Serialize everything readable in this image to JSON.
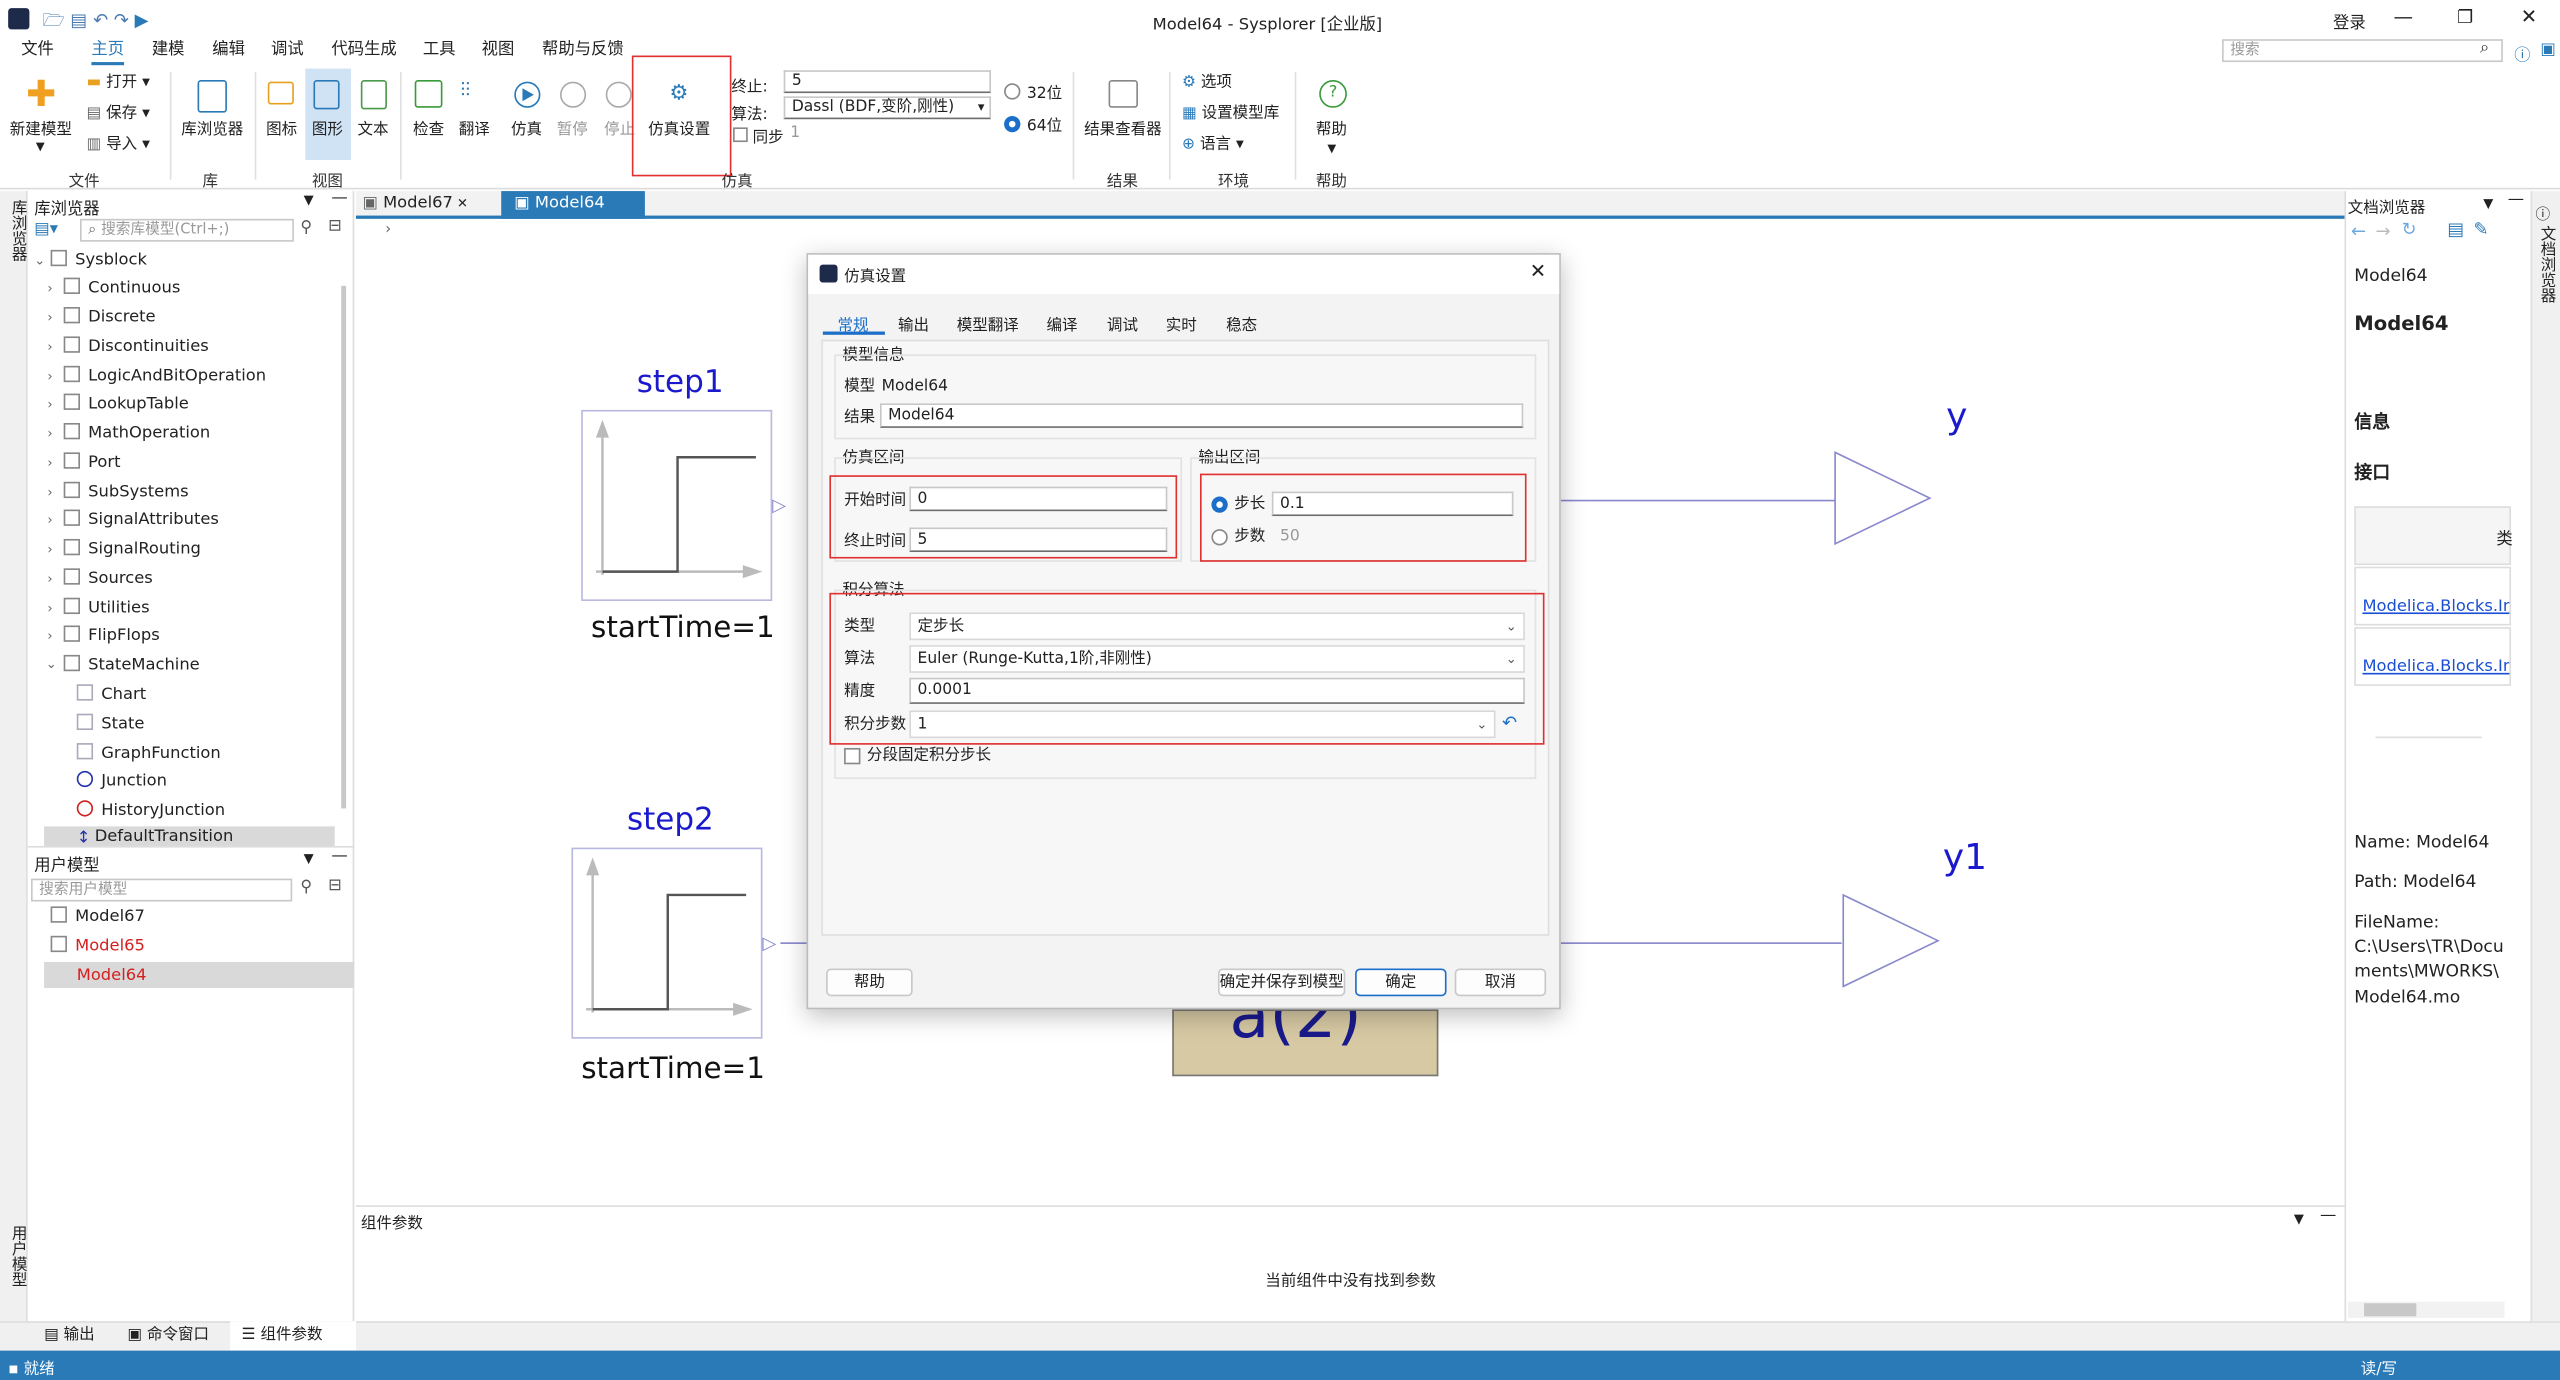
{
  "window": {
    "title": "Model64 - Sysplorer [企业版]",
    "login": "登录",
    "search_placeholder": "搜索"
  },
  "menu": [
    "文件",
    "主页",
    "建模",
    "编辑",
    "调试",
    "代码生成",
    "工具",
    "视图",
    "帮助与反馈"
  ],
  "ribbon": {
    "file": {
      "new_model": "新建模型",
      "open": "打开",
      "save": "保存",
      "import": "导入",
      "group": "文件"
    },
    "lib": {
      "browser": "库浏览器",
      "group": "库"
    },
    "view": {
      "icon": "图标",
      "diagram": "图形",
      "text": "文本",
      "group": "视图"
    },
    "sim": {
      "check": "检查",
      "translate": "翻译",
      "simulate": "仿真",
      "pause": "暂停",
      "stop": "停止",
      "settings": "仿真设置",
      "group": "仿真",
      "stop_label": "终止:",
      "stop_value": "5",
      "alg_label": "算法:",
      "alg_value": "Dassl (BDF,变阶,刚性)",
      "sync": "同步",
      "sync_value": "1",
      "bit32": "32位",
      "bit64": "64位"
    },
    "result": {
      "viewer": "结果查看器",
      "group": "结果"
    },
    "env": {
      "options": "选项",
      "set_lib": "设置模型库",
      "language": "语言",
      "group": "环境"
    },
    "help": {
      "help": "帮助",
      "group": "帮助"
    }
  },
  "left_panel": {
    "title": "库浏览器",
    "search_placeholder": "搜索库模型(Ctrl+;)",
    "root": "Sysblock",
    "items": [
      "Continuous",
      "Discrete",
      "Discontinuities",
      "LogicAndBitOperation",
      "LookupTable",
      "MathOperation",
      "Port",
      "SubSystems",
      "SignalAttributes",
      "SignalRouting",
      "Sources",
      "Utilities",
      "FlipFlops",
      "StateMachine"
    ],
    "sm_children": [
      "Chart",
      "State",
      "GraphFunction",
      "Junction",
      "HistoryJunction",
      "DefaultTransition"
    ],
    "user_title": "用户模型",
    "user_search": "搜索用户模型",
    "user_models": [
      "Model67",
      "Model65",
      "Model64"
    ],
    "side_tab_top": "库浏览器",
    "side_tab_bottom": "用户模型"
  },
  "tabs": [
    "Model67",
    "Model64"
  ],
  "canvas": {
    "step1": "step1",
    "step2": "step2",
    "start1": "startTime=1",
    "start2": "startTime=1",
    "y": "y",
    "y1": "y1",
    "behind": "a(2)"
  },
  "params_panel": {
    "title": "组件参数",
    "empty": "当前组件中没有找到参数"
  },
  "bottom_tabs": [
    "输出",
    "命令窗口",
    "组件参数"
  ],
  "status": {
    "left": "就绪",
    "right": "读/写"
  },
  "right_panel": {
    "title": "文档浏览器",
    "side_tab": "文档浏览器",
    "model": "Model64",
    "model_bold": "Model64",
    "info": "信息",
    "interface": "接口",
    "col": "类",
    "link1": "Modelica.Blocks.In",
    "link2": "Modelica.Blocks.In",
    "name": "Name: Model64",
    "path": "Path: Model64",
    "filename": [
      "FileName:",
      "C:\\Users\\TR\\Docu",
      "ments\\MWORKS\\",
      "Model64.mo"
    ]
  },
  "dialog": {
    "title": "仿真设置",
    "tabs": [
      "常规",
      "输出",
      "模型翻译",
      "编译",
      "调试",
      "实时",
      "稳态"
    ],
    "model_info": "模型信息",
    "model_label": "模型",
    "model_value": "Model64",
    "result_label": "结果",
    "result_value": "Model64",
    "sim_interval": "仿真区间",
    "start_label": "开始时间",
    "start_value": "0",
    "stop_label": "终止时间",
    "stop_value": "5",
    "out_interval": "输出区间",
    "step_label": "步长",
    "step_value": "0.1",
    "count_label": "步数",
    "count_value": "50",
    "integ": "积分算法",
    "type_label": "类型",
    "type_value": "定步长",
    "alg_label": "算法",
    "alg_value": "Euler (Runge-Kutta,1阶,非刚性)",
    "prec_label": "精度",
    "prec_value": "0.0001",
    "steps_label": "积分步数",
    "steps_value": "1",
    "piecewise": "分段固定积分步长",
    "help": "帮助",
    "save_ok": "确定并保存到模型",
    "ok": "确定",
    "cancel": "取消"
  }
}
